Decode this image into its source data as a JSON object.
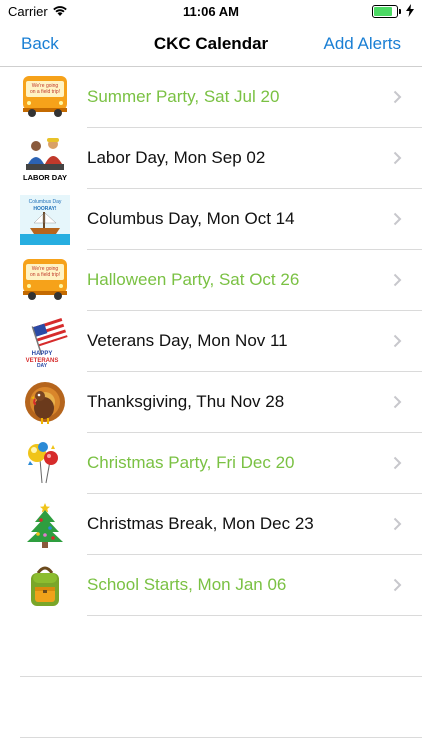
{
  "status_bar": {
    "carrier": "Carrier",
    "time": "11:06 AM",
    "battery_level": 0.9
  },
  "nav": {
    "back_label": "Back",
    "title": "CKC Calendar",
    "right_label": "Add Alerts"
  },
  "colors": {
    "accent": "#1a7fd4",
    "party_green": "#7ac143",
    "text": "#111111"
  },
  "events": [
    {
      "label": "Summer Party, Sat Jul 20",
      "highlight": true,
      "icon": "bus-icon"
    },
    {
      "label": "Labor Day, Mon Sep 02",
      "highlight": false,
      "icon": "labor-day-icon"
    },
    {
      "label": "Columbus Day, Mon Oct 14",
      "highlight": false,
      "icon": "ship-icon"
    },
    {
      "label": "Halloween Party, Sat Oct 26",
      "highlight": true,
      "icon": "bus-icon"
    },
    {
      "label": "Veterans Day, Mon Nov 11",
      "highlight": false,
      "icon": "flag-icon"
    },
    {
      "label": "Thanksgiving, Thu Nov 28",
      "highlight": false,
      "icon": "turkey-icon"
    },
    {
      "label": "Christmas Party, Fri Dec 20",
      "highlight": true,
      "icon": "ornaments-icon"
    },
    {
      "label": "Christmas Break, Mon Dec 23",
      "highlight": false,
      "icon": "tree-icon"
    },
    {
      "label": "School Starts, Mon Jan 06",
      "highlight": true,
      "icon": "backpack-icon"
    }
  ],
  "icon_text": {
    "bus_sign": "We're going on a field trip!",
    "labor_day": "LABOR DAY",
    "columbus": "Columbus Day HOORAY!",
    "veterans": "HAPPY VETERANS DAY"
  }
}
